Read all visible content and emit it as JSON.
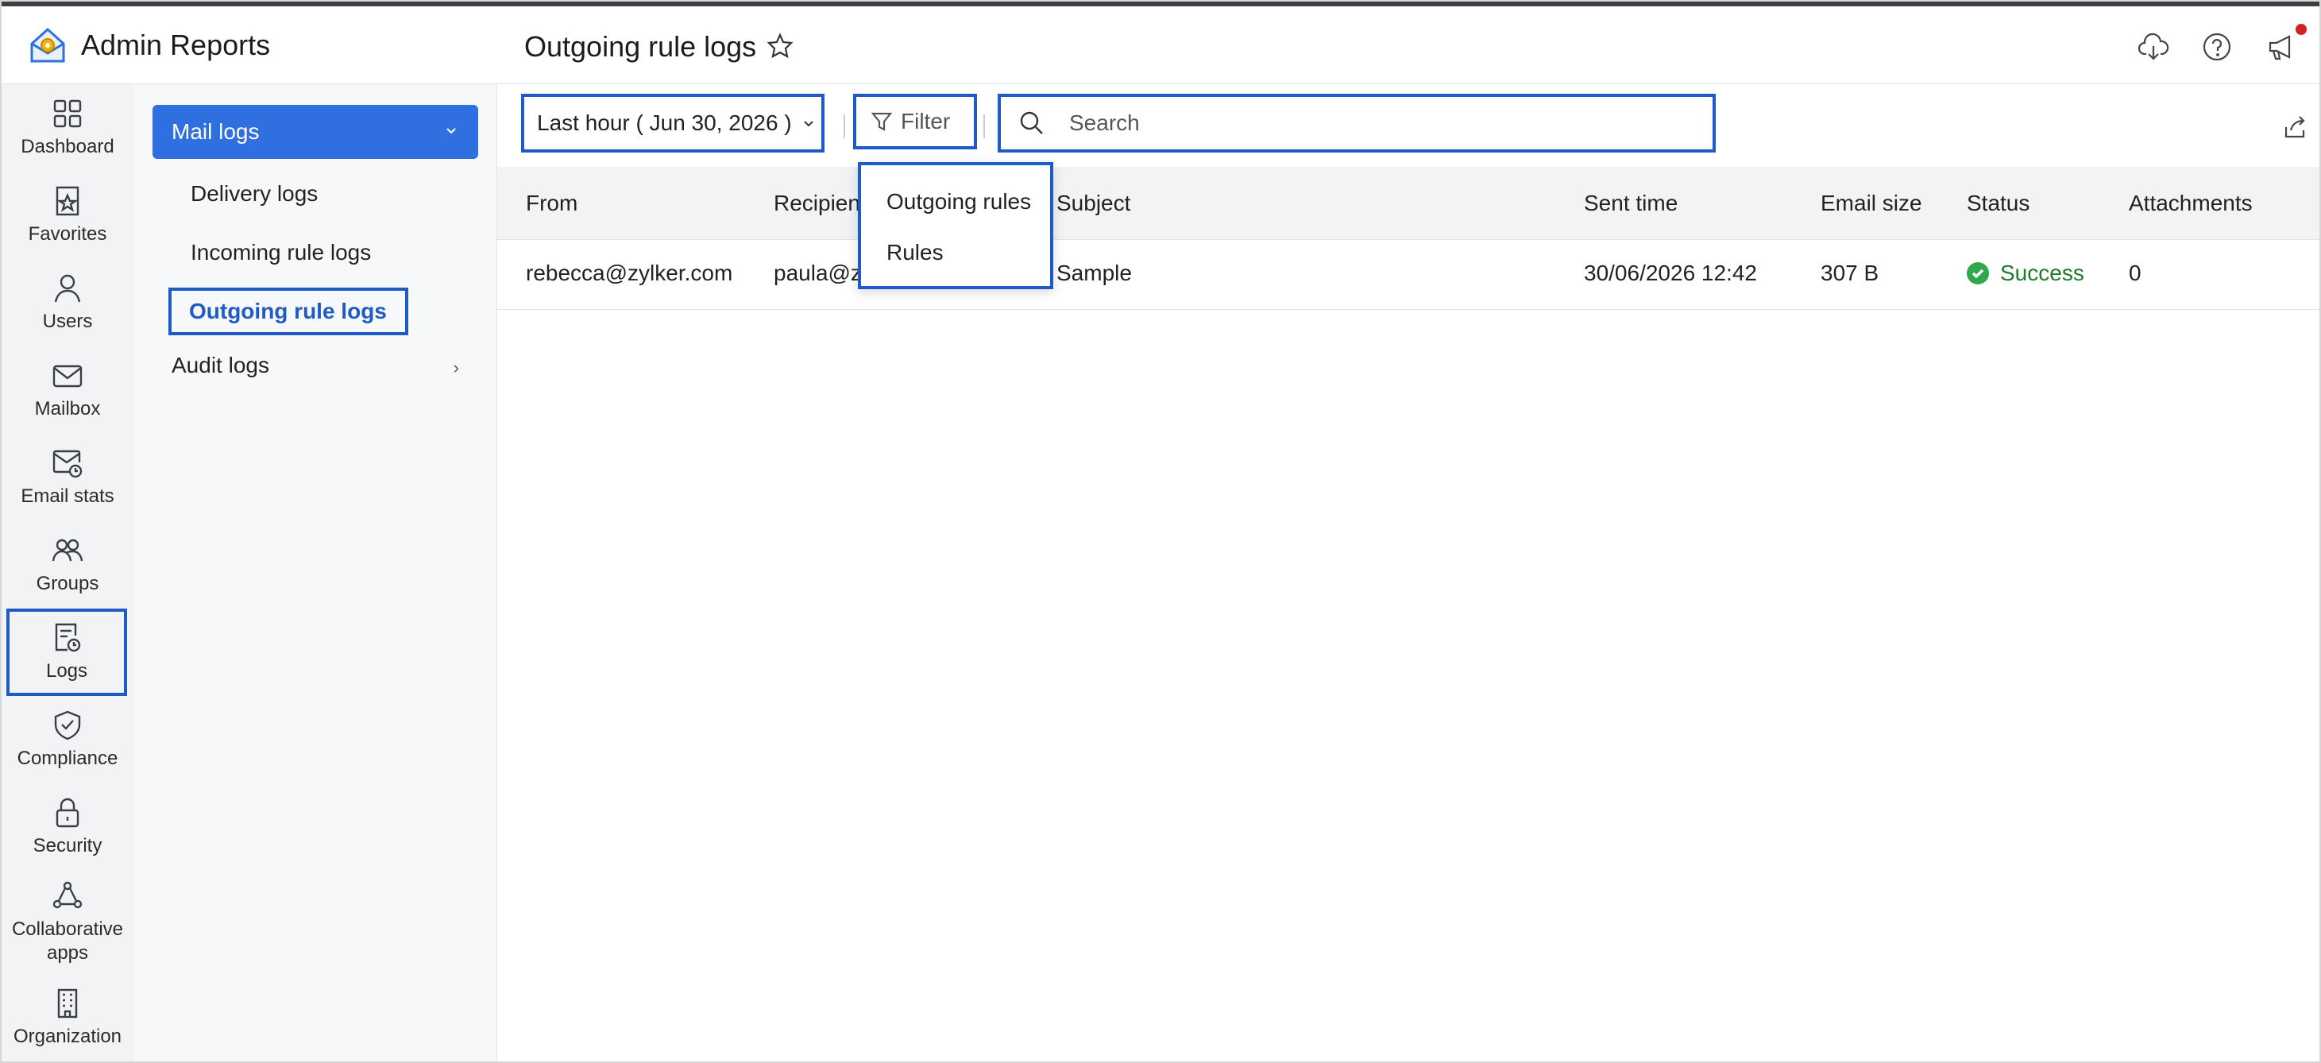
{
  "app": {
    "title": "Admin Reports"
  },
  "rail": [
    {
      "label": "Dashboard",
      "icon": "grid-icon"
    },
    {
      "label": "Favorites",
      "icon": "favorites-icon"
    },
    {
      "label": "Users",
      "icon": "user-icon"
    },
    {
      "label": "Mailbox",
      "icon": "mail-icon"
    },
    {
      "label": "Email stats",
      "icon": "mail-clock-icon"
    },
    {
      "label": "Groups",
      "icon": "groups-icon"
    },
    {
      "label": "Logs",
      "icon": "logs-icon",
      "selected": true
    },
    {
      "label": "Compliance",
      "icon": "shield-check-icon"
    },
    {
      "label": "Security",
      "icon": "lock-icon"
    },
    {
      "label": "Collaborative\napps",
      "icon": "collab-icon"
    },
    {
      "label": "Organization",
      "icon": "building-icon"
    }
  ],
  "subnav": {
    "group_label": "Mail logs",
    "items": [
      "Delivery logs",
      "Incoming rule logs",
      "Outgoing rule logs"
    ],
    "active_item": "Outgoing rule logs",
    "audit_label": "Audit logs"
  },
  "header": {
    "title": "Outgoing rule logs"
  },
  "toolbar": {
    "range_label": "Last hour ( Jun 30, 2026 )",
    "filter_label": "Filter",
    "search_placeholder": "Search"
  },
  "filter_menu": [
    "Outgoing rules",
    "Rules"
  ],
  "table": {
    "columns": [
      "From",
      "Recipient",
      "Subject",
      "Sent time",
      "Email size",
      "Status",
      "Attachments"
    ],
    "rows": [
      {
        "from": "rebecca@zylker.com",
        "recipient": "paula@zy",
        "subject": "Sample",
        "sent_time": "30/06/2026 12:42",
        "size": "307 B",
        "status": "Success",
        "attachments": "0"
      }
    ]
  },
  "colors": {
    "accent": "#2f6fe0",
    "highlight_border": "#1e5bc6",
    "success": "#2da84a",
    "notification": "#d32222"
  }
}
